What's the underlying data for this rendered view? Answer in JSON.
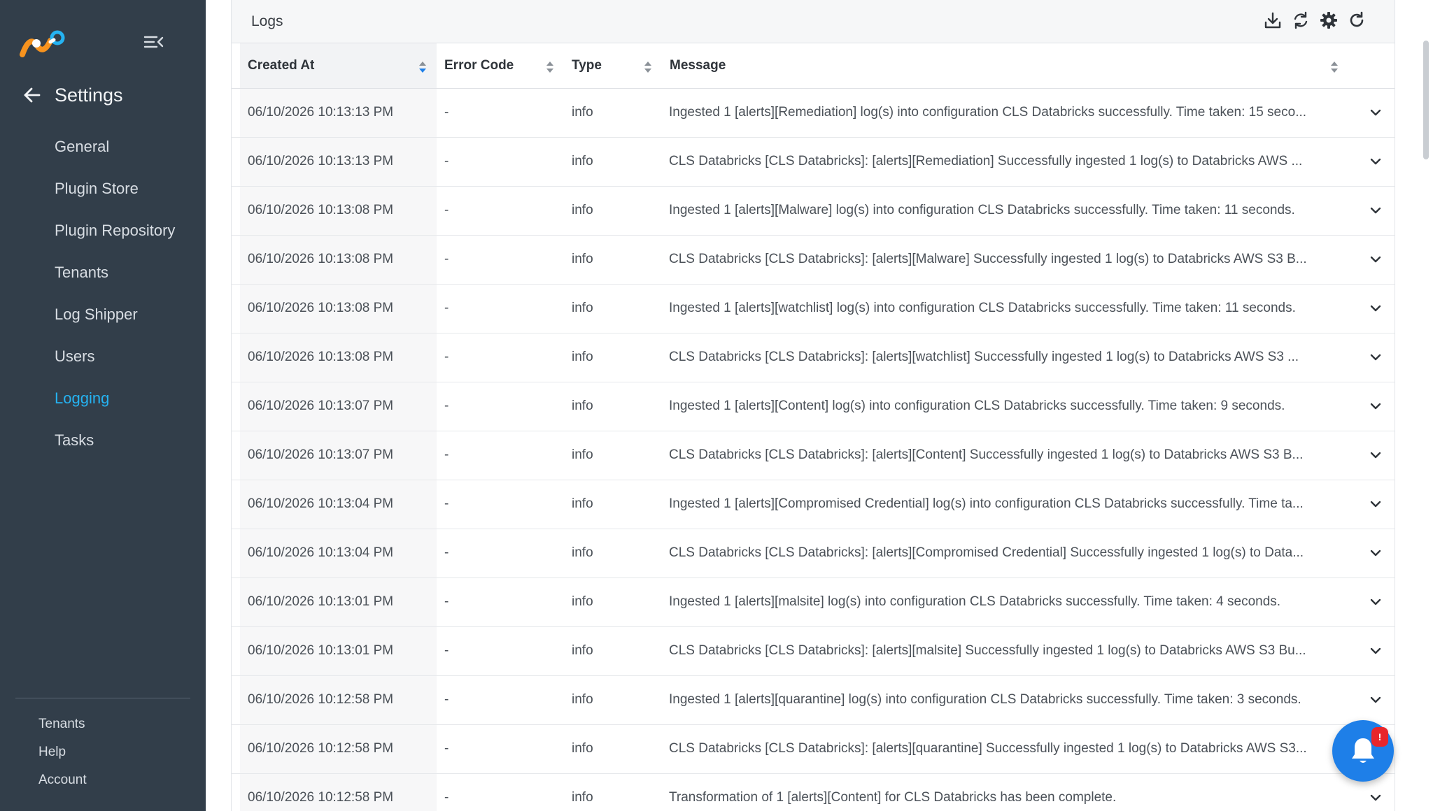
{
  "sidebar": {
    "title": "Settings",
    "items": [
      {
        "label": "General"
      },
      {
        "label": "Plugin Store"
      },
      {
        "label": "Plugin Repository"
      },
      {
        "label": "Tenants"
      },
      {
        "label": "Log Shipper"
      },
      {
        "label": "Users"
      },
      {
        "label": "Logging",
        "active": true
      },
      {
        "label": "Tasks"
      }
    ],
    "footer": [
      {
        "label": "Tenants"
      },
      {
        "label": "Help"
      },
      {
        "label": "Account"
      }
    ]
  },
  "logs": {
    "title": "Logs",
    "toolbar": [
      "download-icon",
      "sync-icon",
      "gear-icon",
      "refresh-icon"
    ],
    "columns": {
      "created_at": "Created At",
      "error_code": "Error Code",
      "type": "Type",
      "message": "Message"
    },
    "rows": [
      {
        "created_at": "06/10/2026 10:13:13 PM",
        "error_code": "-",
        "type": "info",
        "message": "Ingested 1 [alerts][Remediation] log(s) into configuration CLS Databricks successfully. Time taken: 15 seco..."
      },
      {
        "created_at": "06/10/2026 10:13:13 PM",
        "error_code": "-",
        "type": "info",
        "message": "CLS Databricks [CLS Databricks]: [alerts][Remediation] Successfully ingested 1 log(s) to Databricks AWS ..."
      },
      {
        "created_at": "06/10/2026 10:13:08 PM",
        "error_code": "-",
        "type": "info",
        "message": "Ingested 1 [alerts][Malware] log(s) into configuration CLS Databricks successfully. Time taken: 11 seconds."
      },
      {
        "created_at": "06/10/2026 10:13:08 PM",
        "error_code": "-",
        "type": "info",
        "message": "CLS Databricks [CLS Databricks]: [alerts][Malware] Successfully ingested 1 log(s) to Databricks AWS S3 B..."
      },
      {
        "created_at": "06/10/2026 10:13:08 PM",
        "error_code": "-",
        "type": "info",
        "message": "Ingested 1 [alerts][watchlist] log(s) into configuration CLS Databricks successfully. Time taken: 11 seconds."
      },
      {
        "created_at": "06/10/2026 10:13:08 PM",
        "error_code": "-",
        "type": "info",
        "message": "CLS Databricks [CLS Databricks]: [alerts][watchlist] Successfully ingested 1 log(s) to Databricks AWS S3 ..."
      },
      {
        "created_at": "06/10/2026 10:13:07 PM",
        "error_code": "-",
        "type": "info",
        "message": "Ingested 1 [alerts][Content] log(s) into configuration CLS Databricks successfully. Time taken: 9 seconds."
      },
      {
        "created_at": "06/10/2026 10:13:07 PM",
        "error_code": "-",
        "type": "info",
        "message": "CLS Databricks [CLS Databricks]: [alerts][Content] Successfully ingested 1 log(s) to Databricks AWS S3 B..."
      },
      {
        "created_at": "06/10/2026 10:13:04 PM",
        "error_code": "-",
        "type": "info",
        "message": "Ingested 1 [alerts][Compromised Credential] log(s) into configuration CLS Databricks successfully. Time ta..."
      },
      {
        "created_at": "06/10/2026 10:13:04 PM",
        "error_code": "-",
        "type": "info",
        "message": "CLS Databricks [CLS Databricks]: [alerts][Compromised Credential] Successfully ingested 1 log(s) to Data..."
      },
      {
        "created_at": "06/10/2026 10:13:01 PM",
        "error_code": "-",
        "type": "info",
        "message": "Ingested 1 [alerts][malsite] log(s) into configuration CLS Databricks successfully. Time taken: 4 seconds."
      },
      {
        "created_at": "06/10/2026 10:13:01 PM",
        "error_code": "-",
        "type": "info",
        "message": "CLS Databricks [CLS Databricks]: [alerts][malsite] Successfully ingested 1 log(s) to Databricks AWS S3 Bu..."
      },
      {
        "created_at": "06/10/2026 10:12:58 PM",
        "error_code": "-",
        "type": "info",
        "message": "Ingested 1 [alerts][quarantine] log(s) into configuration CLS Databricks successfully. Time taken: 3 seconds."
      },
      {
        "created_at": "06/10/2026 10:12:58 PM",
        "error_code": "-",
        "type": "info",
        "message": "CLS Databricks [CLS Databricks]: [alerts][quarantine] Successfully ingested 1 log(s) to Databricks AWS S3..."
      },
      {
        "created_at": "06/10/2026 10:12:58 PM",
        "error_code": "-",
        "type": "info",
        "message": "Transformation of 1 [alerts][Content] for CLS Databricks has been complete."
      }
    ]
  },
  "notification": {
    "badge": "!"
  },
  "colors": {
    "sidebar_bg": "#323e4a",
    "accent": "#25b3f2",
    "fab": "#1e7fe8",
    "badge": "#e8262b"
  }
}
